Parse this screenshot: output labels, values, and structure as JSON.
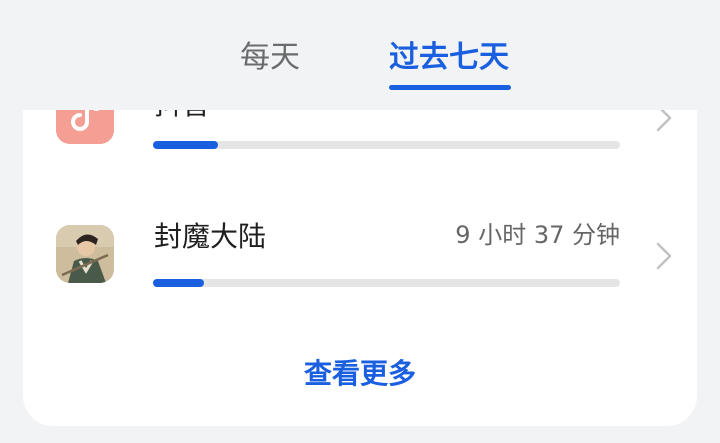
{
  "tabs": {
    "daily_label": "每天",
    "week_label": "过去七天"
  },
  "apps": [
    {
      "name": "抖音",
      "time": "",
      "usage_fraction": 0.14,
      "icon": "douyin-icon"
    },
    {
      "name": "封魔大陆",
      "time": "9 小时 37 分钟",
      "usage_fraction": 0.11,
      "icon": "game-app-icon"
    }
  ],
  "view_more_label": "查看更多",
  "colors": {
    "accent": "#1a5fe0",
    "background": "#f1f3f5",
    "card": "#ffffff",
    "track": "#e5e5e5",
    "douyin_icon_bg": "#f59e93"
  }
}
